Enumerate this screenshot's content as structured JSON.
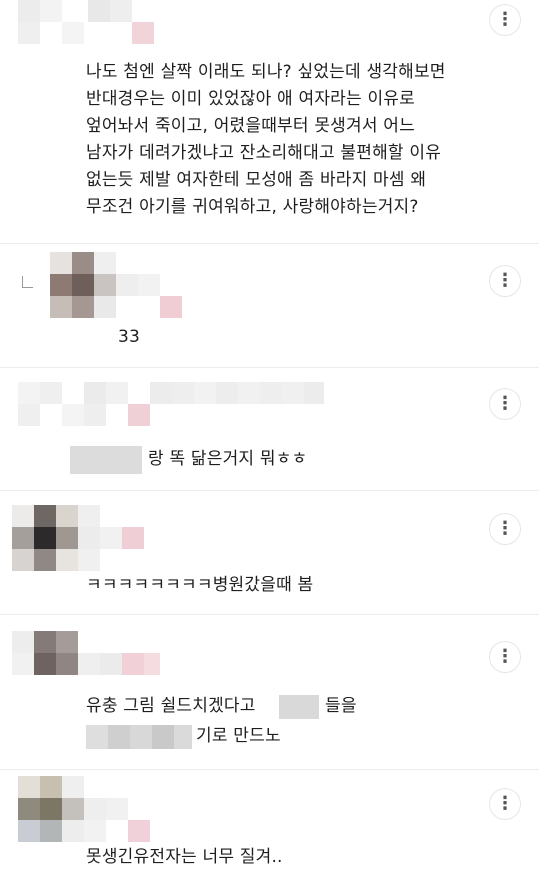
{
  "comments": [
    {
      "text": "나도 첨엔 살짝 이래도 되나? 싶었는데 생각해보면\n반대경우는 이미 있었잖아 애 여자라는 이유로\n엎어놔서 죽이고, 어렸을때부터 못생겨서 어느\n남자가 데려가겠냐고 잔소리해대고 불편해할 이유\n없는듯 제발 여자한테 모성애 좀 바라지 마셈 왜\n무조건 아기를 귀여워하고, 사랑해야하는거지?"
    },
    {
      "text": "33"
    },
    {
      "text": "랑 똑 닮은거지 뭐ㅎㅎ"
    },
    {
      "text": "ㅋㅋㅋㅋㅋㅋㅋㅋ병원갔을때 봄"
    },
    {
      "text_a": "유충 그림 쉴드치겠다고",
      "text_b": "들을",
      "text_c": "기로 만드노"
    },
    {
      "text": "못생긴유전자는 너무 질겨.."
    }
  ],
  "more_icon": "more-vertical-icon",
  "reply_icon": "reply-arrow-icon"
}
